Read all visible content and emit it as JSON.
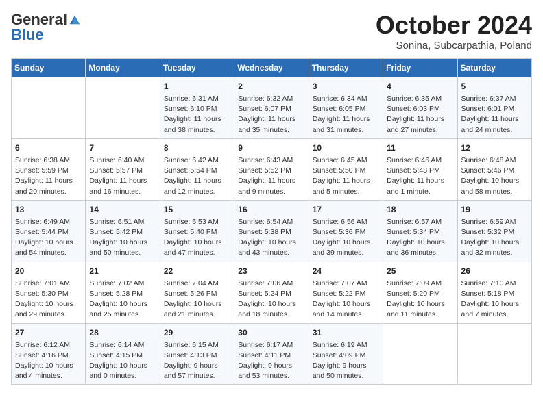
{
  "logo": {
    "general": "General",
    "blue": "Blue"
  },
  "title": "October 2024",
  "subtitle": "Sonina, Subcarpathia, Poland",
  "days_of_week": [
    "Sunday",
    "Monday",
    "Tuesday",
    "Wednesday",
    "Thursday",
    "Friday",
    "Saturday"
  ],
  "weeks": [
    [
      {
        "day": "",
        "sunrise": "",
        "sunset": "",
        "daylight": ""
      },
      {
        "day": "",
        "sunrise": "",
        "sunset": "",
        "daylight": ""
      },
      {
        "day": "1",
        "sunrise": "Sunrise: 6:31 AM",
        "sunset": "Sunset: 6:10 PM",
        "daylight": "Daylight: 11 hours and 38 minutes."
      },
      {
        "day": "2",
        "sunrise": "Sunrise: 6:32 AM",
        "sunset": "Sunset: 6:07 PM",
        "daylight": "Daylight: 11 hours and 35 minutes."
      },
      {
        "day": "3",
        "sunrise": "Sunrise: 6:34 AM",
        "sunset": "Sunset: 6:05 PM",
        "daylight": "Daylight: 11 hours and 31 minutes."
      },
      {
        "day": "4",
        "sunrise": "Sunrise: 6:35 AM",
        "sunset": "Sunset: 6:03 PM",
        "daylight": "Daylight: 11 hours and 27 minutes."
      },
      {
        "day": "5",
        "sunrise": "Sunrise: 6:37 AM",
        "sunset": "Sunset: 6:01 PM",
        "daylight": "Daylight: 11 hours and 24 minutes."
      }
    ],
    [
      {
        "day": "6",
        "sunrise": "Sunrise: 6:38 AM",
        "sunset": "Sunset: 5:59 PM",
        "daylight": "Daylight: 11 hours and 20 minutes."
      },
      {
        "day": "7",
        "sunrise": "Sunrise: 6:40 AM",
        "sunset": "Sunset: 5:57 PM",
        "daylight": "Daylight: 11 hours and 16 minutes."
      },
      {
        "day": "8",
        "sunrise": "Sunrise: 6:42 AM",
        "sunset": "Sunset: 5:54 PM",
        "daylight": "Daylight: 11 hours and 12 minutes."
      },
      {
        "day": "9",
        "sunrise": "Sunrise: 6:43 AM",
        "sunset": "Sunset: 5:52 PM",
        "daylight": "Daylight: 11 hours and 9 minutes."
      },
      {
        "day": "10",
        "sunrise": "Sunrise: 6:45 AM",
        "sunset": "Sunset: 5:50 PM",
        "daylight": "Daylight: 11 hours and 5 minutes."
      },
      {
        "day": "11",
        "sunrise": "Sunrise: 6:46 AM",
        "sunset": "Sunset: 5:48 PM",
        "daylight": "Daylight: 11 hours and 1 minute."
      },
      {
        "day": "12",
        "sunrise": "Sunrise: 6:48 AM",
        "sunset": "Sunset: 5:46 PM",
        "daylight": "Daylight: 10 hours and 58 minutes."
      }
    ],
    [
      {
        "day": "13",
        "sunrise": "Sunrise: 6:49 AM",
        "sunset": "Sunset: 5:44 PM",
        "daylight": "Daylight: 10 hours and 54 minutes."
      },
      {
        "day": "14",
        "sunrise": "Sunrise: 6:51 AM",
        "sunset": "Sunset: 5:42 PM",
        "daylight": "Daylight: 10 hours and 50 minutes."
      },
      {
        "day": "15",
        "sunrise": "Sunrise: 6:53 AM",
        "sunset": "Sunset: 5:40 PM",
        "daylight": "Daylight: 10 hours and 47 minutes."
      },
      {
        "day": "16",
        "sunrise": "Sunrise: 6:54 AM",
        "sunset": "Sunset: 5:38 PM",
        "daylight": "Daylight: 10 hours and 43 minutes."
      },
      {
        "day": "17",
        "sunrise": "Sunrise: 6:56 AM",
        "sunset": "Sunset: 5:36 PM",
        "daylight": "Daylight: 10 hours and 39 minutes."
      },
      {
        "day": "18",
        "sunrise": "Sunrise: 6:57 AM",
        "sunset": "Sunset: 5:34 PM",
        "daylight": "Daylight: 10 hours and 36 minutes."
      },
      {
        "day": "19",
        "sunrise": "Sunrise: 6:59 AM",
        "sunset": "Sunset: 5:32 PM",
        "daylight": "Daylight: 10 hours and 32 minutes."
      }
    ],
    [
      {
        "day": "20",
        "sunrise": "Sunrise: 7:01 AM",
        "sunset": "Sunset: 5:30 PM",
        "daylight": "Daylight: 10 hours and 29 minutes."
      },
      {
        "day": "21",
        "sunrise": "Sunrise: 7:02 AM",
        "sunset": "Sunset: 5:28 PM",
        "daylight": "Daylight: 10 hours and 25 minutes."
      },
      {
        "day": "22",
        "sunrise": "Sunrise: 7:04 AM",
        "sunset": "Sunset: 5:26 PM",
        "daylight": "Daylight: 10 hours and 21 minutes."
      },
      {
        "day": "23",
        "sunrise": "Sunrise: 7:06 AM",
        "sunset": "Sunset: 5:24 PM",
        "daylight": "Daylight: 10 hours and 18 minutes."
      },
      {
        "day": "24",
        "sunrise": "Sunrise: 7:07 AM",
        "sunset": "Sunset: 5:22 PM",
        "daylight": "Daylight: 10 hours and 14 minutes."
      },
      {
        "day": "25",
        "sunrise": "Sunrise: 7:09 AM",
        "sunset": "Sunset: 5:20 PM",
        "daylight": "Daylight: 10 hours and 11 minutes."
      },
      {
        "day": "26",
        "sunrise": "Sunrise: 7:10 AM",
        "sunset": "Sunset: 5:18 PM",
        "daylight": "Daylight: 10 hours and 7 minutes."
      }
    ],
    [
      {
        "day": "27",
        "sunrise": "Sunrise: 6:12 AM",
        "sunset": "Sunset: 4:16 PM",
        "daylight": "Daylight: 10 hours and 4 minutes."
      },
      {
        "day": "28",
        "sunrise": "Sunrise: 6:14 AM",
        "sunset": "Sunset: 4:15 PM",
        "daylight": "Daylight: 10 hours and 0 minutes."
      },
      {
        "day": "29",
        "sunrise": "Sunrise: 6:15 AM",
        "sunset": "Sunset: 4:13 PM",
        "daylight": "Daylight: 9 hours and 57 minutes."
      },
      {
        "day": "30",
        "sunrise": "Sunrise: 6:17 AM",
        "sunset": "Sunset: 4:11 PM",
        "daylight": "Daylight: 9 hours and 53 minutes."
      },
      {
        "day": "31",
        "sunrise": "Sunrise: 6:19 AM",
        "sunset": "Sunset: 4:09 PM",
        "daylight": "Daylight: 9 hours and 50 minutes."
      },
      {
        "day": "",
        "sunrise": "",
        "sunset": "",
        "daylight": ""
      },
      {
        "day": "",
        "sunrise": "",
        "sunset": "",
        "daylight": ""
      }
    ]
  ]
}
